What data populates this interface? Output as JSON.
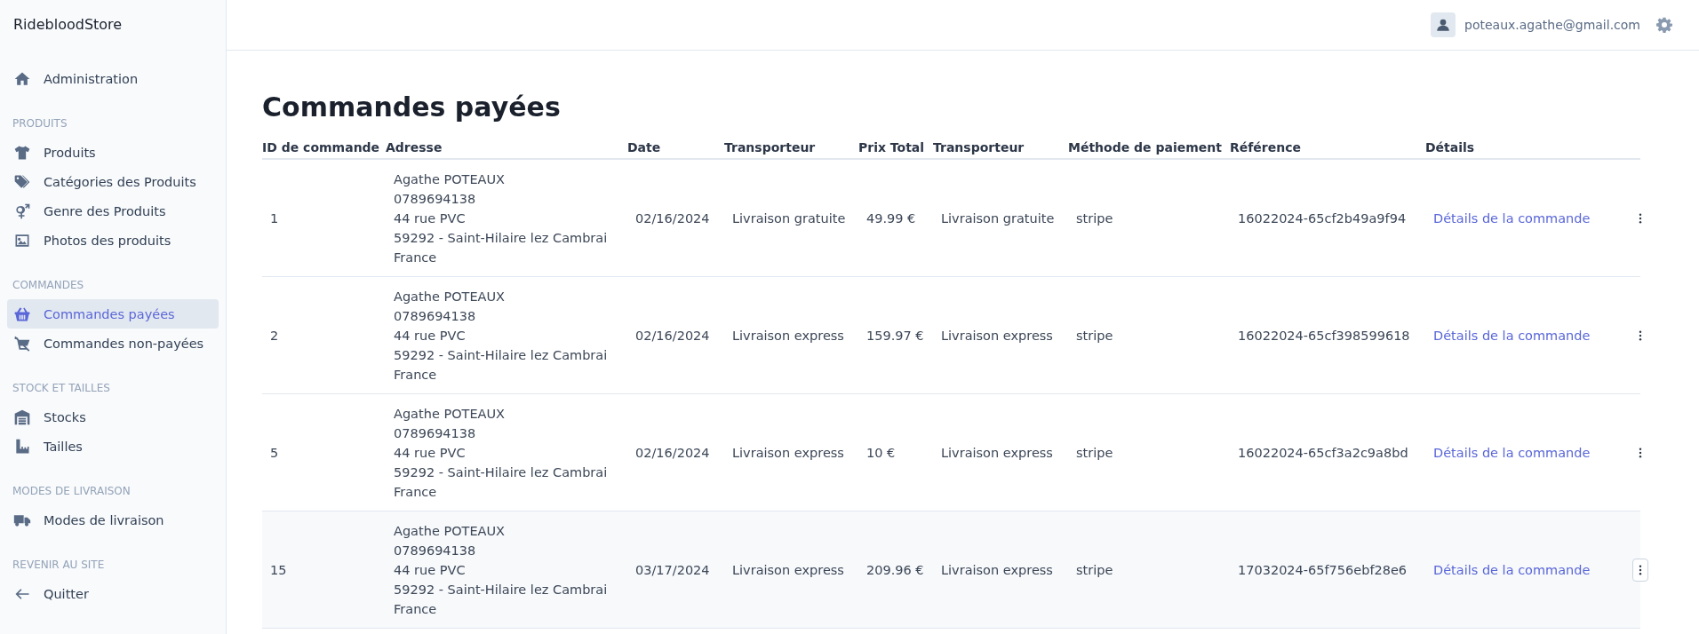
{
  "sidebar": {
    "brand": "RidebloodStore",
    "sections": [
      {
        "items": [
          {
            "label": "Administration",
            "selected": false
          }
        ]
      },
      {
        "heading": "PRODUITS",
        "items": [
          {
            "label": "Produits",
            "selected": false
          },
          {
            "label": "Catégories des Produits",
            "selected": false
          },
          {
            "label": "Genre des Produits",
            "selected": false
          },
          {
            "label": "Photos des produits",
            "selected": false
          }
        ]
      },
      {
        "heading": "COMMANDES",
        "items": [
          {
            "label": "Commandes payées",
            "selected": true
          },
          {
            "label": "Commandes non-payées",
            "selected": false
          }
        ]
      },
      {
        "heading": "STOCK ET TAILLES",
        "items": [
          {
            "label": "Stocks",
            "selected": false
          },
          {
            "label": "Tailles",
            "selected": false
          }
        ]
      },
      {
        "heading": "MODES DE LIVRAISON",
        "items": [
          {
            "label": "Modes de livraison",
            "selected": false
          }
        ]
      },
      {
        "heading": "REVENIR AU SITE",
        "items": [
          {
            "label": "Quitter",
            "selected": false
          }
        ]
      }
    ]
  },
  "header": {
    "user_email": "poteaux.agathe@gmail.com"
  },
  "page_title": "Commandes payées",
  "table": {
    "columns": [
      "ID de commande",
      "Adresse",
      "Date",
      "Transporteur",
      "Prix Total",
      "Transporteur",
      "Méthode de paiement",
      "Référence",
      "Détails"
    ],
    "rows": [
      {
        "id": "1",
        "address": [
          "Agathe POTEAUX",
          "0789694138",
          "44 rue PVC",
          "59292 - Saint-Hilaire lez Cambrai",
          "France"
        ],
        "date": "02/16/2024",
        "carrier": "Livraison gratuite",
        "total": "49.99 €",
        "carrier_2": "Livraison gratuite",
        "payment": "stripe",
        "reference": "16022024-65cf2b49a9f94",
        "details_link": "Détails de la commande",
        "highlighted": false
      },
      {
        "id": "2",
        "address": [
          "Agathe POTEAUX",
          "0789694138",
          "44 rue PVC",
          "59292 - Saint-Hilaire lez Cambrai",
          "France"
        ],
        "date": "02/16/2024",
        "carrier": "Livraison express",
        "total": "159.97 €",
        "carrier_2": "Livraison express",
        "payment": "stripe",
        "reference": "16022024-65cf398599618",
        "details_link": "Détails de la commande",
        "highlighted": false
      },
      {
        "id": "5",
        "address": [
          "Agathe POTEAUX",
          "0789694138",
          "44 rue PVC",
          "59292 - Saint-Hilaire lez Cambrai",
          "France"
        ],
        "date": "02/16/2024",
        "carrier": "Livraison express",
        "total": "10 €",
        "carrier_2": "Livraison express",
        "payment": "stripe",
        "reference": "16022024-65cf3a2c9a8bd",
        "details_link": "Détails de la commande",
        "highlighted": false
      },
      {
        "id": "15",
        "address": [
          "Agathe POTEAUX",
          "0789694138",
          "44 rue PVC",
          "59292 - Saint-Hilaire lez Cambrai",
          "France"
        ],
        "date": "03/17/2024",
        "carrier": "Livraison express",
        "total": "209.96 €",
        "carrier_2": "Livraison express",
        "payment": "stripe",
        "reference": "17032024-65f756ebf28e6",
        "details_link": "Détails de la commande",
        "highlighted": true
      }
    ]
  }
}
